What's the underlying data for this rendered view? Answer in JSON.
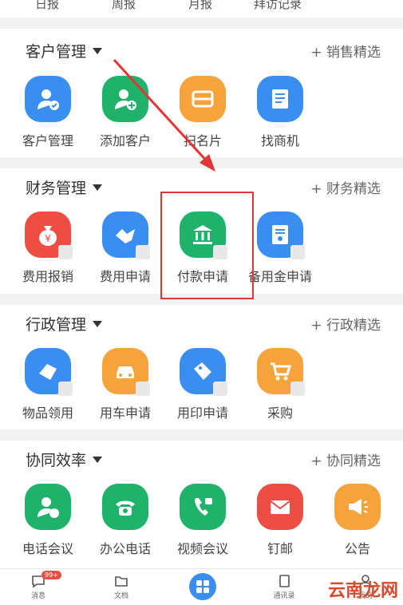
{
  "top_partial": [
    "日报",
    "周报",
    "月报",
    "拜访记录"
  ],
  "sections": [
    {
      "title": "客户管理",
      "more": "+ 销售精选",
      "items": [
        {
          "label": "客户管理",
          "color": "#3a8ef0",
          "icon": "person-check-icon"
        },
        {
          "label": "添加客户",
          "color": "#1fb26b",
          "icon": "person-add-icon"
        },
        {
          "label": "扫名片",
          "color": "#f7a33c",
          "icon": "scan-card-icon"
        },
        {
          "label": "找商机",
          "color": "#3a8ef0",
          "icon": "document-icon"
        }
      ]
    },
    {
      "title": "财务管理",
      "more": "+ 财务精选",
      "items": [
        {
          "label": "费用报销",
          "color": "#ee4d44",
          "icon": "money-bag-icon"
        },
        {
          "label": "费用申请",
          "color": "#3a8ef0",
          "icon": "handshake-icon"
        },
        {
          "label": "付款申请",
          "color": "#1fb26b",
          "icon": "bank-icon"
        },
        {
          "label": "备用金申请",
          "color": "#3a8ef0",
          "icon": "certificate-icon"
        }
      ]
    },
    {
      "title": "行政管理",
      "more": "+ 行政精选",
      "items": [
        {
          "label": "物品领用",
          "color": "#3a8ef0",
          "icon": "hand-item-icon"
        },
        {
          "label": "用车申请",
          "color": "#f7a33c",
          "icon": "car-icon"
        },
        {
          "label": "用印申请",
          "color": "#3a8ef0",
          "icon": "tag-icon"
        },
        {
          "label": "采购",
          "color": "#f7a33c",
          "icon": "cart-icon"
        }
      ]
    },
    {
      "title": "协同效率",
      "more": "+ 协同精选",
      "items": [
        {
          "label": "电话会议",
          "color": "#1fb26b",
          "icon": "phone-meeting-icon"
        },
        {
          "label": "办公电话",
          "color": "#1fb26b",
          "icon": "telephone-icon"
        },
        {
          "label": "视频会议",
          "color": "#1fb26b",
          "icon": "video-call-icon"
        },
        {
          "label": "钉邮",
          "color": "#ee4d44",
          "icon": "mail-icon"
        },
        {
          "label": "公告",
          "color": "#f7a33c",
          "icon": "megaphone-icon"
        }
      ]
    }
  ],
  "bottom_nav": [
    {
      "label": "消息",
      "icon": "chat-icon",
      "badge": "99+"
    },
    {
      "label": "文档",
      "icon": "folder-icon"
    },
    {
      "label": "",
      "icon": "apps-grid-icon"
    },
    {
      "label": "通讯录",
      "icon": "contacts-icon"
    },
    {
      "label": "我的",
      "icon": "user-icon"
    }
  ],
  "watermark": "云南龙网"
}
